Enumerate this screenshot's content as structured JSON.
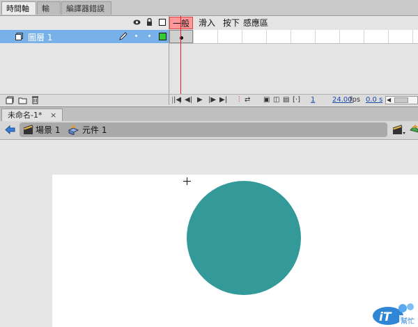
{
  "panel_tabs": [
    "時間軸",
    "輸出",
    "編譯器錯誤"
  ],
  "timeline": {
    "layer_name": "圖層 1",
    "frame_labels": [
      "一般",
      "滑入",
      "按下",
      "感應區"
    ],
    "fps": "24.00",
    "fps_unit": "fps",
    "current_frame": "1",
    "time": "0.0 s"
  },
  "document": {
    "tab_title": "未命名-1*"
  },
  "edit_bar": {
    "scene_label": "場景 1",
    "symbol_label": "元件 1"
  },
  "stage": {
    "circle_color": "#339999"
  },
  "watermark": {
    "logo_text": "iT",
    "brand_text": "幫忙"
  },
  "colors": {
    "layer_selected": "#78b1ea",
    "playhead": "#e02020",
    "frame_label_active_bg": "#ff9999",
    "layer_color_swatch": "#33cc33"
  }
}
